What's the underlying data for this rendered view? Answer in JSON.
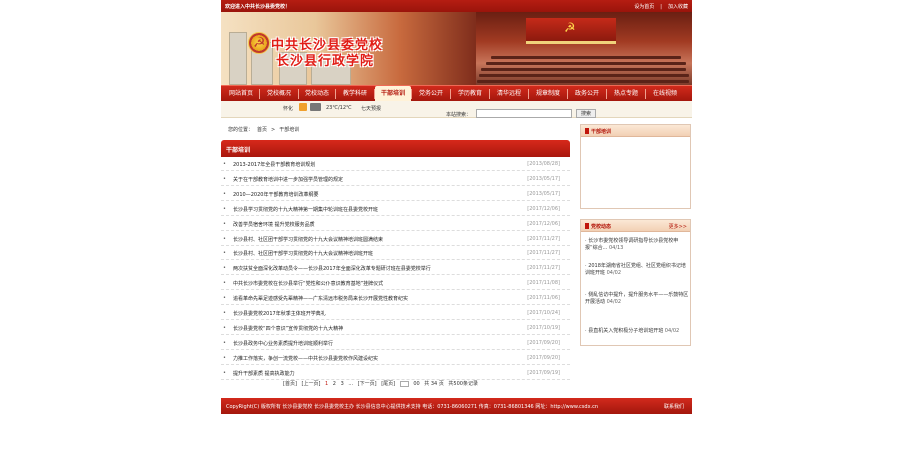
{
  "topbar": {
    "welcome": "欢迎进入中共长沙县委党校！",
    "set_home": "设为首页",
    "add_fav": "加入收藏"
  },
  "banner": {
    "title_line1": "中共长沙县委党校",
    "title_line2": "长沙县行政学院"
  },
  "nav": {
    "items": [
      "网站首页",
      "党校概况",
      "党校动态",
      "教学科研",
      "干部培训",
      "党务公开",
      "学历教育",
      "清华远程",
      "规章制度",
      "政务公开",
      "热点专题",
      "在线视频"
    ],
    "active_index": 4
  },
  "weather": {
    "city": "怀化",
    "temp": "23℃/12℃",
    "forecast": "七天预报",
    "search_label": "本站搜索：",
    "search_btn": "搜索"
  },
  "breadcrumb": {
    "prefix": "您的位置：",
    "home": "首页",
    "sep": ">",
    "current": "干部培训"
  },
  "main": {
    "title": "干部培训",
    "rows": [
      {
        "title": "2013-2017年全县干部教育培训规划",
        "date": "[2013/08/28]"
      },
      {
        "title": "关于在干部教育培训中进一步加强学员管理的规定",
        "date": "[2013/05/17]"
      },
      {
        "title": "2010—2020年干部教育培训改革纲要",
        "date": "[2013/05/17]"
      },
      {
        "title": "长沙县学习贯彻党的十九大精神第一期集中轮训班在县委党校开班",
        "date": "[2017/12/06]"
      },
      {
        "title": "改善学员宿舍环境 提升党校服务品质",
        "date": "[2017/12/06]"
      },
      {
        "title": "长沙县村、社区团干部学习贯彻党的十九大会议精神培训班圆满结束",
        "date": "[2017/11/27]"
      },
      {
        "title": "长沙县村、社区团干部学习贯彻党的十九大会议精神培训班开班",
        "date": "[2017/11/27]"
      },
      {
        "title": "两次扶贫全面深化改革动员令——长沙县2017年全面深化改革专题研讨班在县委党校举行",
        "date": "[2017/11/27]"
      },
      {
        "title": "中共长沙市委党校在长沙县举行“党性和公仆意识教育基地”挂牌仪式",
        "date": "[2017/11/08]"
      },
      {
        "title": "追看革命先辈足迹感受先辈精神——广东清远市税务局来长沙开展党性教育纪实",
        "date": "[2017/11/06]"
      },
      {
        "title": "长沙县委党校2017年秋季主体班开学典礼",
        "date": "[2017/10/24]"
      },
      {
        "title": "长沙县委党校“四个意识”宣传贯彻党的十九大精神",
        "date": "[2017/10/19]"
      },
      {
        "title": "长沙县政务中心业务素质提升培训班顺利举行",
        "date": "[2017/09/20]"
      },
      {
        "title": "力推工作落实，争创一流党校——中共长沙县委党校作风建设纪实",
        "date": "[2017/09/20]"
      },
      {
        "title": "提升干部素质 提高执政能力",
        "date": "[2017/09/19]"
      }
    ]
  },
  "pager": {
    "first": "[首页]",
    "prev": "[上一页]",
    "pages": [
      "1",
      "2",
      "3",
      "..."
    ],
    "next": "[下一页]",
    "last": "[尾页]",
    "jump_value": "00",
    "total_pages": "共 34 页",
    "total_records": "共500条记录"
  },
  "side": {
    "box1_title": "干部培训",
    "box2_title": "党校动态",
    "more": "更多>>",
    "news": [
      {
        "title": "长沙市委党校领导调研指导长沙县党校申报“综合...",
        "date": "04/13"
      },
      {
        "title": "2018年湖南省社区党组、社区党组织书记培训班开班",
        "date": "04/02"
      },
      {
        "title": "侧乱信访中提升，提升服务水平——乐鼓特区开展活动",
        "date": "04/02"
      },
      {
        "title": "县直机关入党积极分子培训班开班",
        "date": "04/02"
      }
    ]
  },
  "footer": {
    "text": "CopyRight(C) 版权所有 长沙县委党校  长沙县委党校主办 长沙县信息中心提供技术支持  电话：0731-86060271 传真：0731-86801346  网址：http://www.csdx.cn",
    "right": "联系我们"
  }
}
